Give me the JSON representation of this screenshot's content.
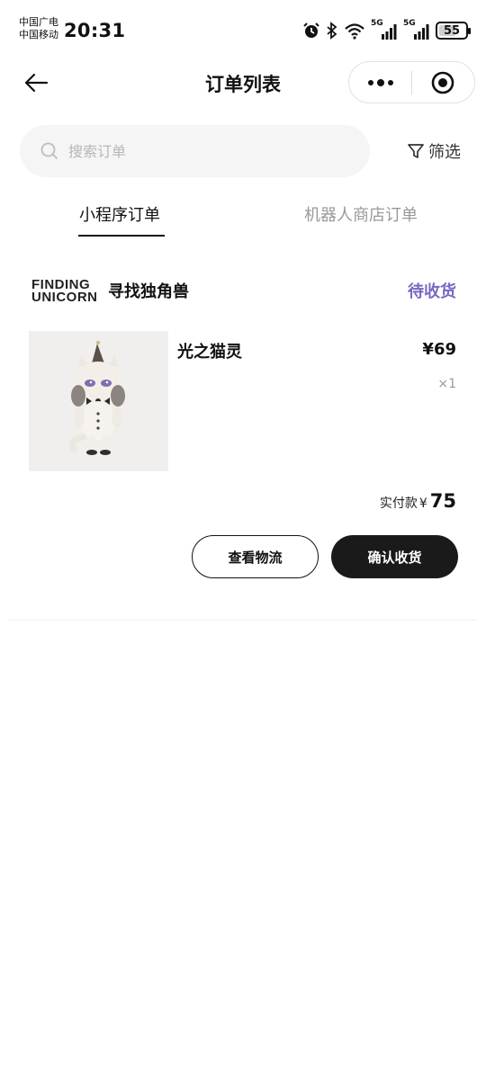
{
  "status_bar": {
    "carrier1": "中国广电",
    "carrier2": "中国移动",
    "time": "20:31",
    "signal1_label": "5G",
    "signal2_label": "5G",
    "battery": "55",
    "battery_level": 0.55
  },
  "nav": {
    "title": "订单列表",
    "back_icon": "arrow-left-icon",
    "more_icon": "more-dots-icon",
    "close_icon": "target-icon"
  },
  "search": {
    "placeholder": "搜索订单",
    "filter_label": "筛选"
  },
  "tabs": [
    {
      "label": "小程序订单",
      "active": true
    },
    {
      "label": "机器人商店订单",
      "active": false
    }
  ],
  "order": {
    "store_logo_line1": "FINDING",
    "store_logo_line2": "UNICORN",
    "store_name": "寻找独角兽",
    "status": "待收货",
    "status_color": "#7a67c2",
    "product_name": "光之猫灵",
    "price": "¥69",
    "quantity": "×1",
    "paid_label": "实付款",
    "paid_currency": "¥",
    "paid_amount": "75",
    "btn_logistics": "查看物流",
    "btn_confirm": "确认收货"
  }
}
